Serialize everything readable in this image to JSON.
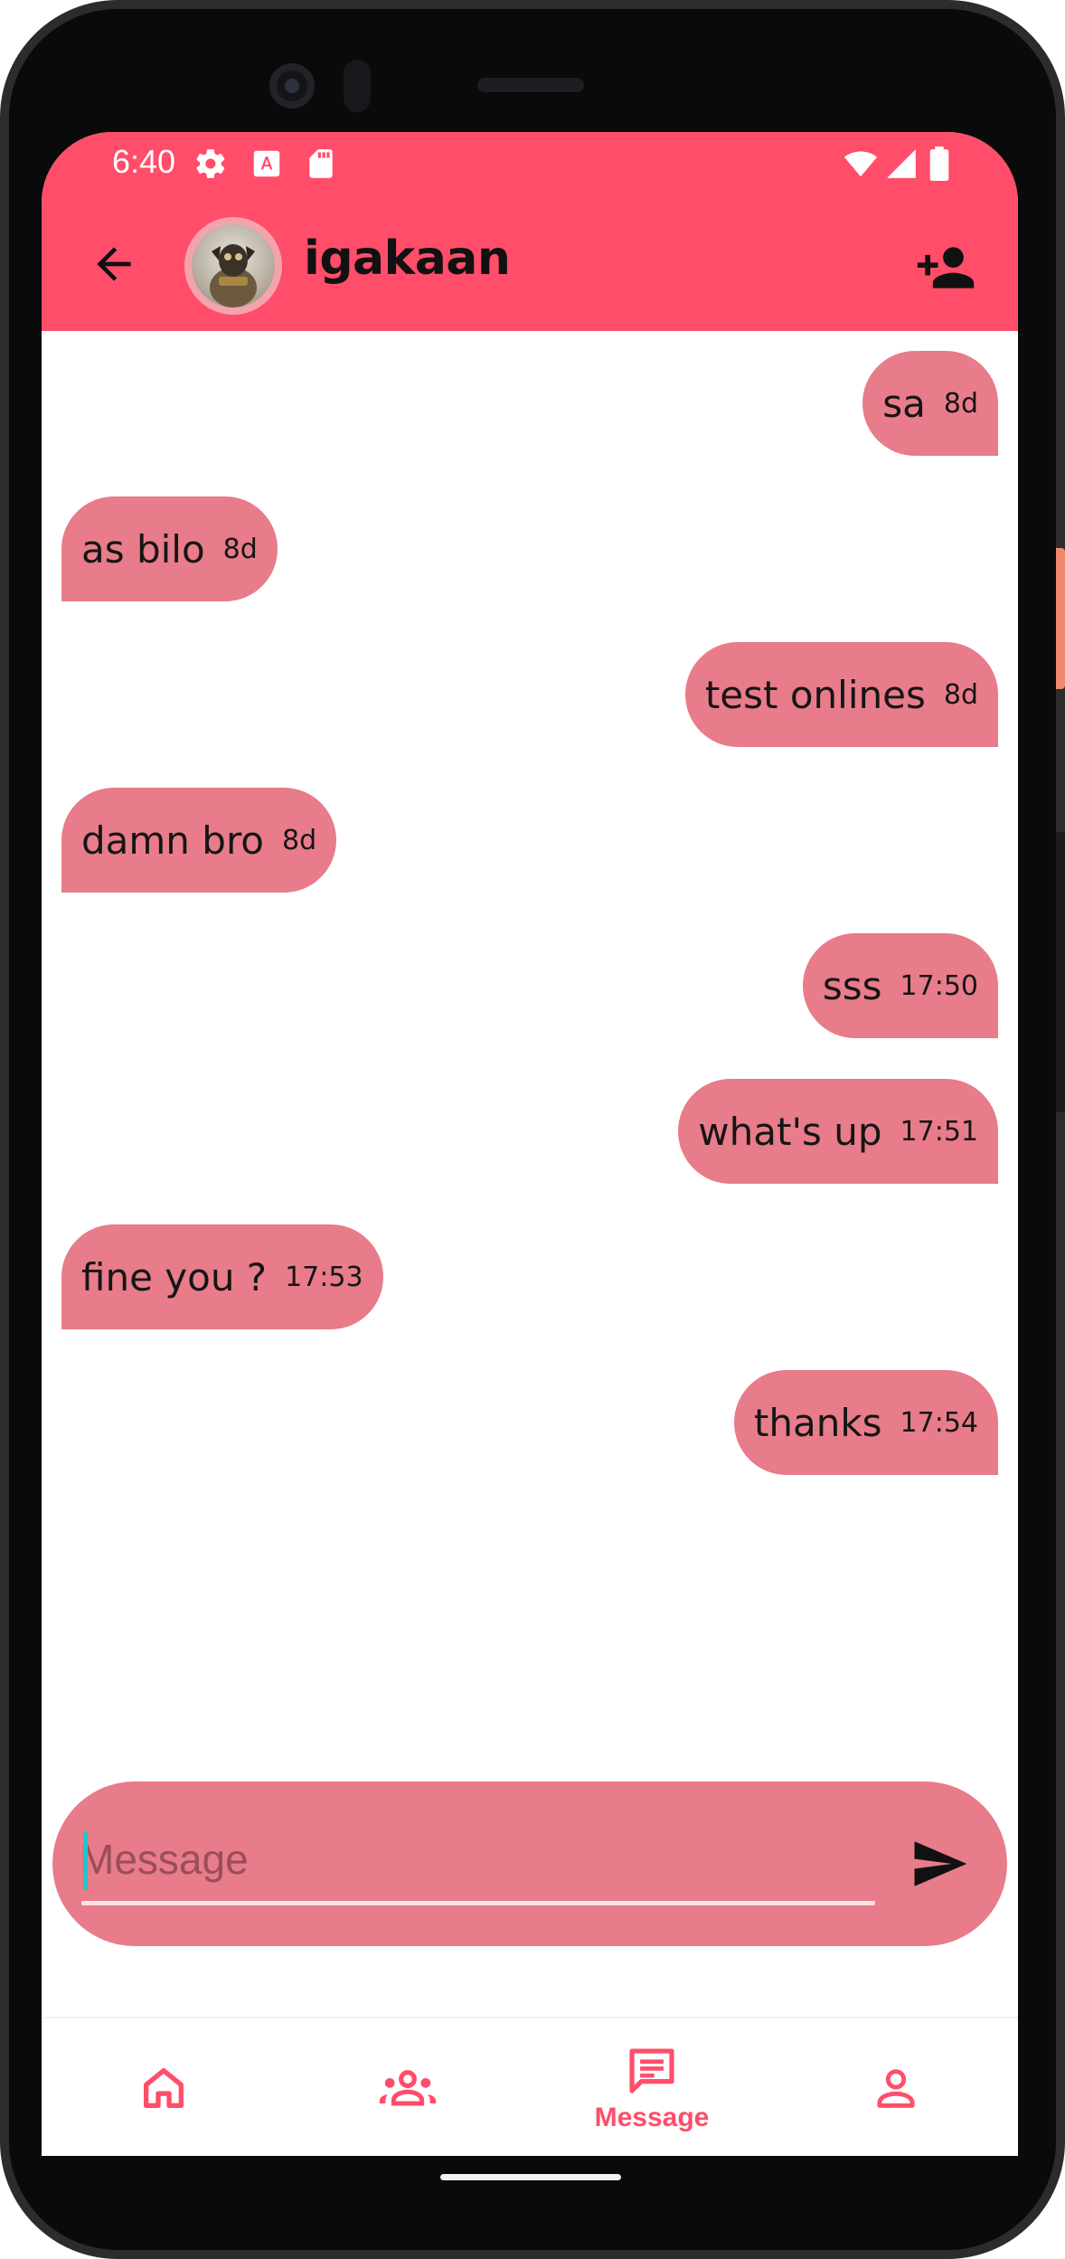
{
  "status_bar": {
    "time": "6:40",
    "icons": [
      "settings-icon",
      "font-icon",
      "sd-card-icon",
      "wifi-icon",
      "signal-icon",
      "battery-icon"
    ]
  },
  "header": {
    "contact_name": "igakaan",
    "back_icon": "arrow-back-icon",
    "add_icon": "person-add-icon"
  },
  "messages": [
    {
      "text": "sa",
      "time": "8d",
      "direction": "outgoing"
    },
    {
      "text": "as bilo",
      "time": "8d",
      "direction": "incoming"
    },
    {
      "text": "test onlines",
      "time": "8d",
      "direction": "outgoing"
    },
    {
      "text": "damn bro",
      "time": "8d",
      "direction": "incoming"
    },
    {
      "text": "sss",
      "time": "17:50",
      "direction": "outgoing"
    },
    {
      "text": "what's up",
      "time": "17:51",
      "direction": "outgoing"
    },
    {
      "text": "fine you ?",
      "time": "17:53",
      "direction": "incoming"
    },
    {
      "text": "thanks",
      "time": "17:54",
      "direction": "outgoing"
    }
  ],
  "composer": {
    "placeholder": "Message",
    "value": "",
    "send_icon": "send-icon"
  },
  "bottom_nav": {
    "items": [
      {
        "icon": "home-icon",
        "label": ""
      },
      {
        "icon": "groups-icon",
        "label": ""
      },
      {
        "icon": "message-icon",
        "label": "Message"
      },
      {
        "icon": "person-icon",
        "label": ""
      }
    ],
    "active": "Message"
  },
  "colors": {
    "accent": "#ff4d6a",
    "bubble": "#e87c8a"
  }
}
